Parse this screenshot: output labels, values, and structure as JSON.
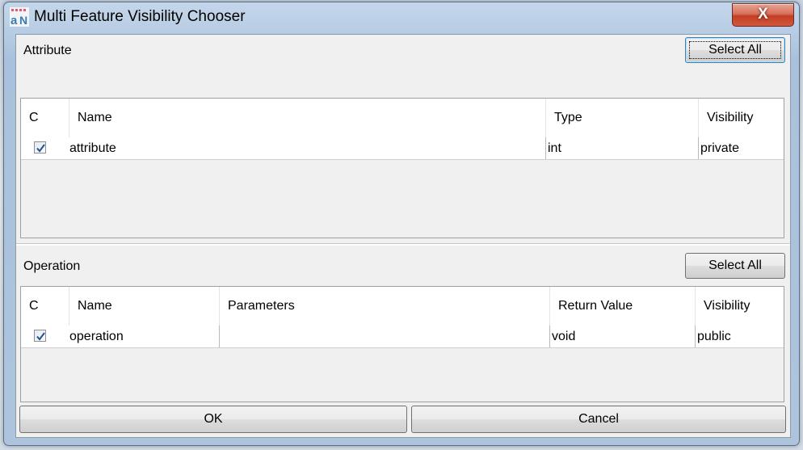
{
  "window": {
    "title": "Multi Feature Visibility Chooser",
    "close_label": "X"
  },
  "attribute_section": {
    "label": "Attribute",
    "select_all_label": "Select All",
    "columns": [
      "C",
      "Name",
      "Type",
      "Visibility"
    ],
    "rows": [
      {
        "checked": true,
        "name": "attribute",
        "type": "int",
        "visibility": "private"
      }
    ]
  },
  "operation_section": {
    "label": "Operation",
    "select_all_label": "Select All",
    "columns": [
      "C",
      "Name",
      "Parameters",
      "Return Value",
      "Visibility"
    ],
    "rows": [
      {
        "checked": true,
        "name": "operation",
        "parameters": "",
        "return_value": "void",
        "visibility": "public"
      }
    ]
  },
  "footer": {
    "ok_label": "OK",
    "cancel_label": "Cancel"
  },
  "colors": {
    "checkmark": "#2a4f8a",
    "close_button": "#c43d23",
    "icon_top": "#e8576b",
    "icon_bottom": "#3a7ab8"
  }
}
